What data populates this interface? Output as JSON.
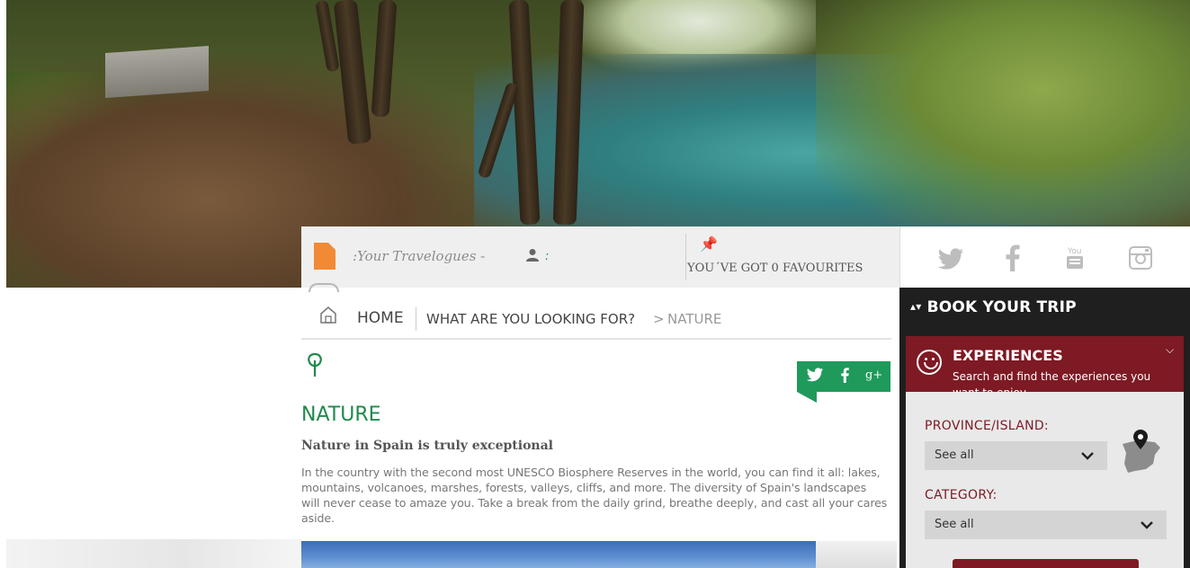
{
  "topbar": {
    "travelogues_label": ":Your Travelogues -",
    "user_count": ":",
    "favourites_label": "YOU´VE GOT 0 FAVOURITES"
  },
  "breadcrumb": {
    "home": "HOME",
    "looking": "WHAT ARE YOU LOOKING FOR?",
    "separator": ">",
    "current": "NATURE"
  },
  "share": {
    "twitter": "twitter-icon",
    "facebook": "facebook-icon",
    "googleplus": "g+"
  },
  "content": {
    "title": "NATURE",
    "subtitle": "Nature in Spain is truly exceptional",
    "body": "In the country with the second most UNESCO Biosphere Reserves in the world, you can find it all: lakes, mountains, volcanoes, marshes, forests, valleys, cliffs, and more. The diversity of Spain's landscapes will never cease to amaze you. Take a break from the daily grind, breathe deeply, and cast all your cares aside."
  },
  "sidebar": {
    "title": "BOOK YOUR TRIP",
    "experiences_title": "EXPERIENCES",
    "experiences_desc": "Search and find the experiences you want to enjoy",
    "province_label": "PROVINCE/ISLAND:",
    "province_value": "See all",
    "category_label": "CATEGORY:",
    "category_value": "See all"
  },
  "colors": {
    "accent_green": "#1f8a4c",
    "share_green": "#1f9a5a",
    "brand_maroon": "#7d1a24",
    "travelogue_orange": "#f28a35"
  },
  "icons": [
    "document-icon",
    "user-icon",
    "pin-icon",
    "home-icon",
    "tree-icon",
    "twitter-icon",
    "facebook-icon",
    "youtube-icon",
    "instagram-icon",
    "smile-icon",
    "chevron-down-icon",
    "spain-map-pin-icon"
  ]
}
